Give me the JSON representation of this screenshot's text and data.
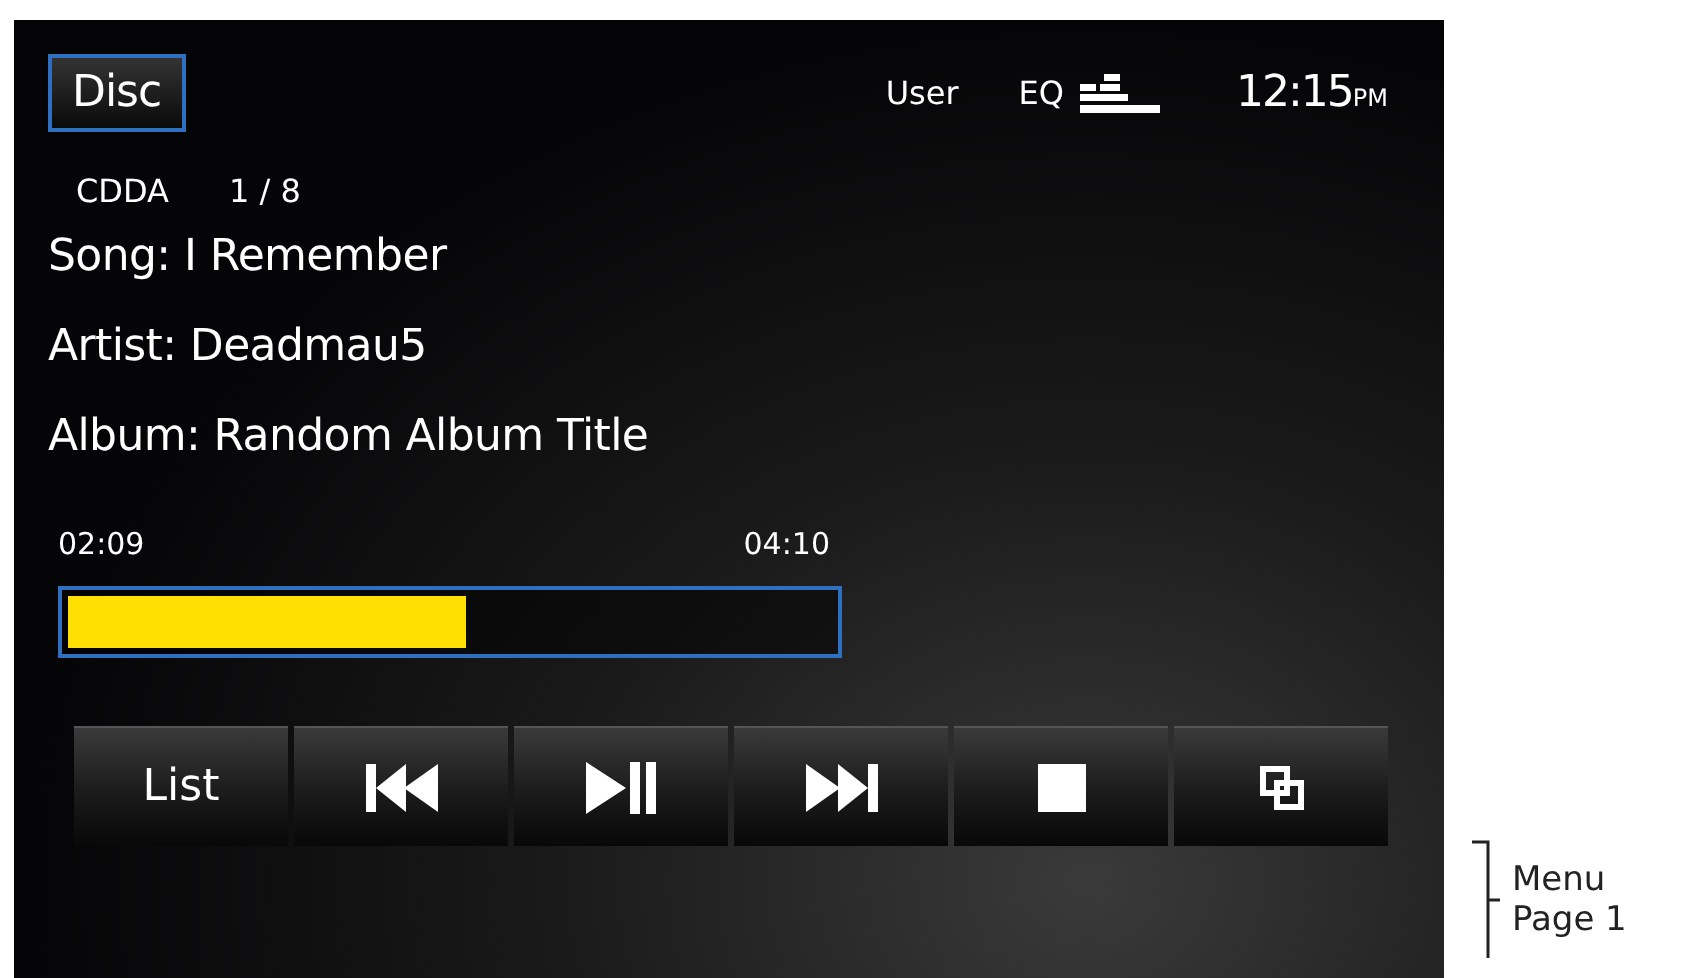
{
  "header": {
    "source_button": {
      "label": "Disc"
    },
    "eq_preset": "User",
    "eq_label": "EQ",
    "clock": "12:15",
    "meridiem": "PM"
  },
  "track": {
    "format": "CDDA",
    "position": "1 / 8",
    "song": "Song: I Remember",
    "artist": "Artist: Deadmau5",
    "album": "Album: Random Album Title"
  },
  "progress": {
    "elapsed": "02:09",
    "total": "04:10",
    "level": 0.52
  },
  "controls": [
    {
      "kind": "text",
      "label": "List"
    },
    {
      "kind": "previous"
    },
    {
      "kind": "play_pause"
    },
    {
      "kind": "next"
    },
    {
      "kind": "stop"
    },
    {
      "kind": "page"
    }
  ],
  "annotation": {
    "lines": [
      "Menu",
      "Page 1"
    ]
  }
}
